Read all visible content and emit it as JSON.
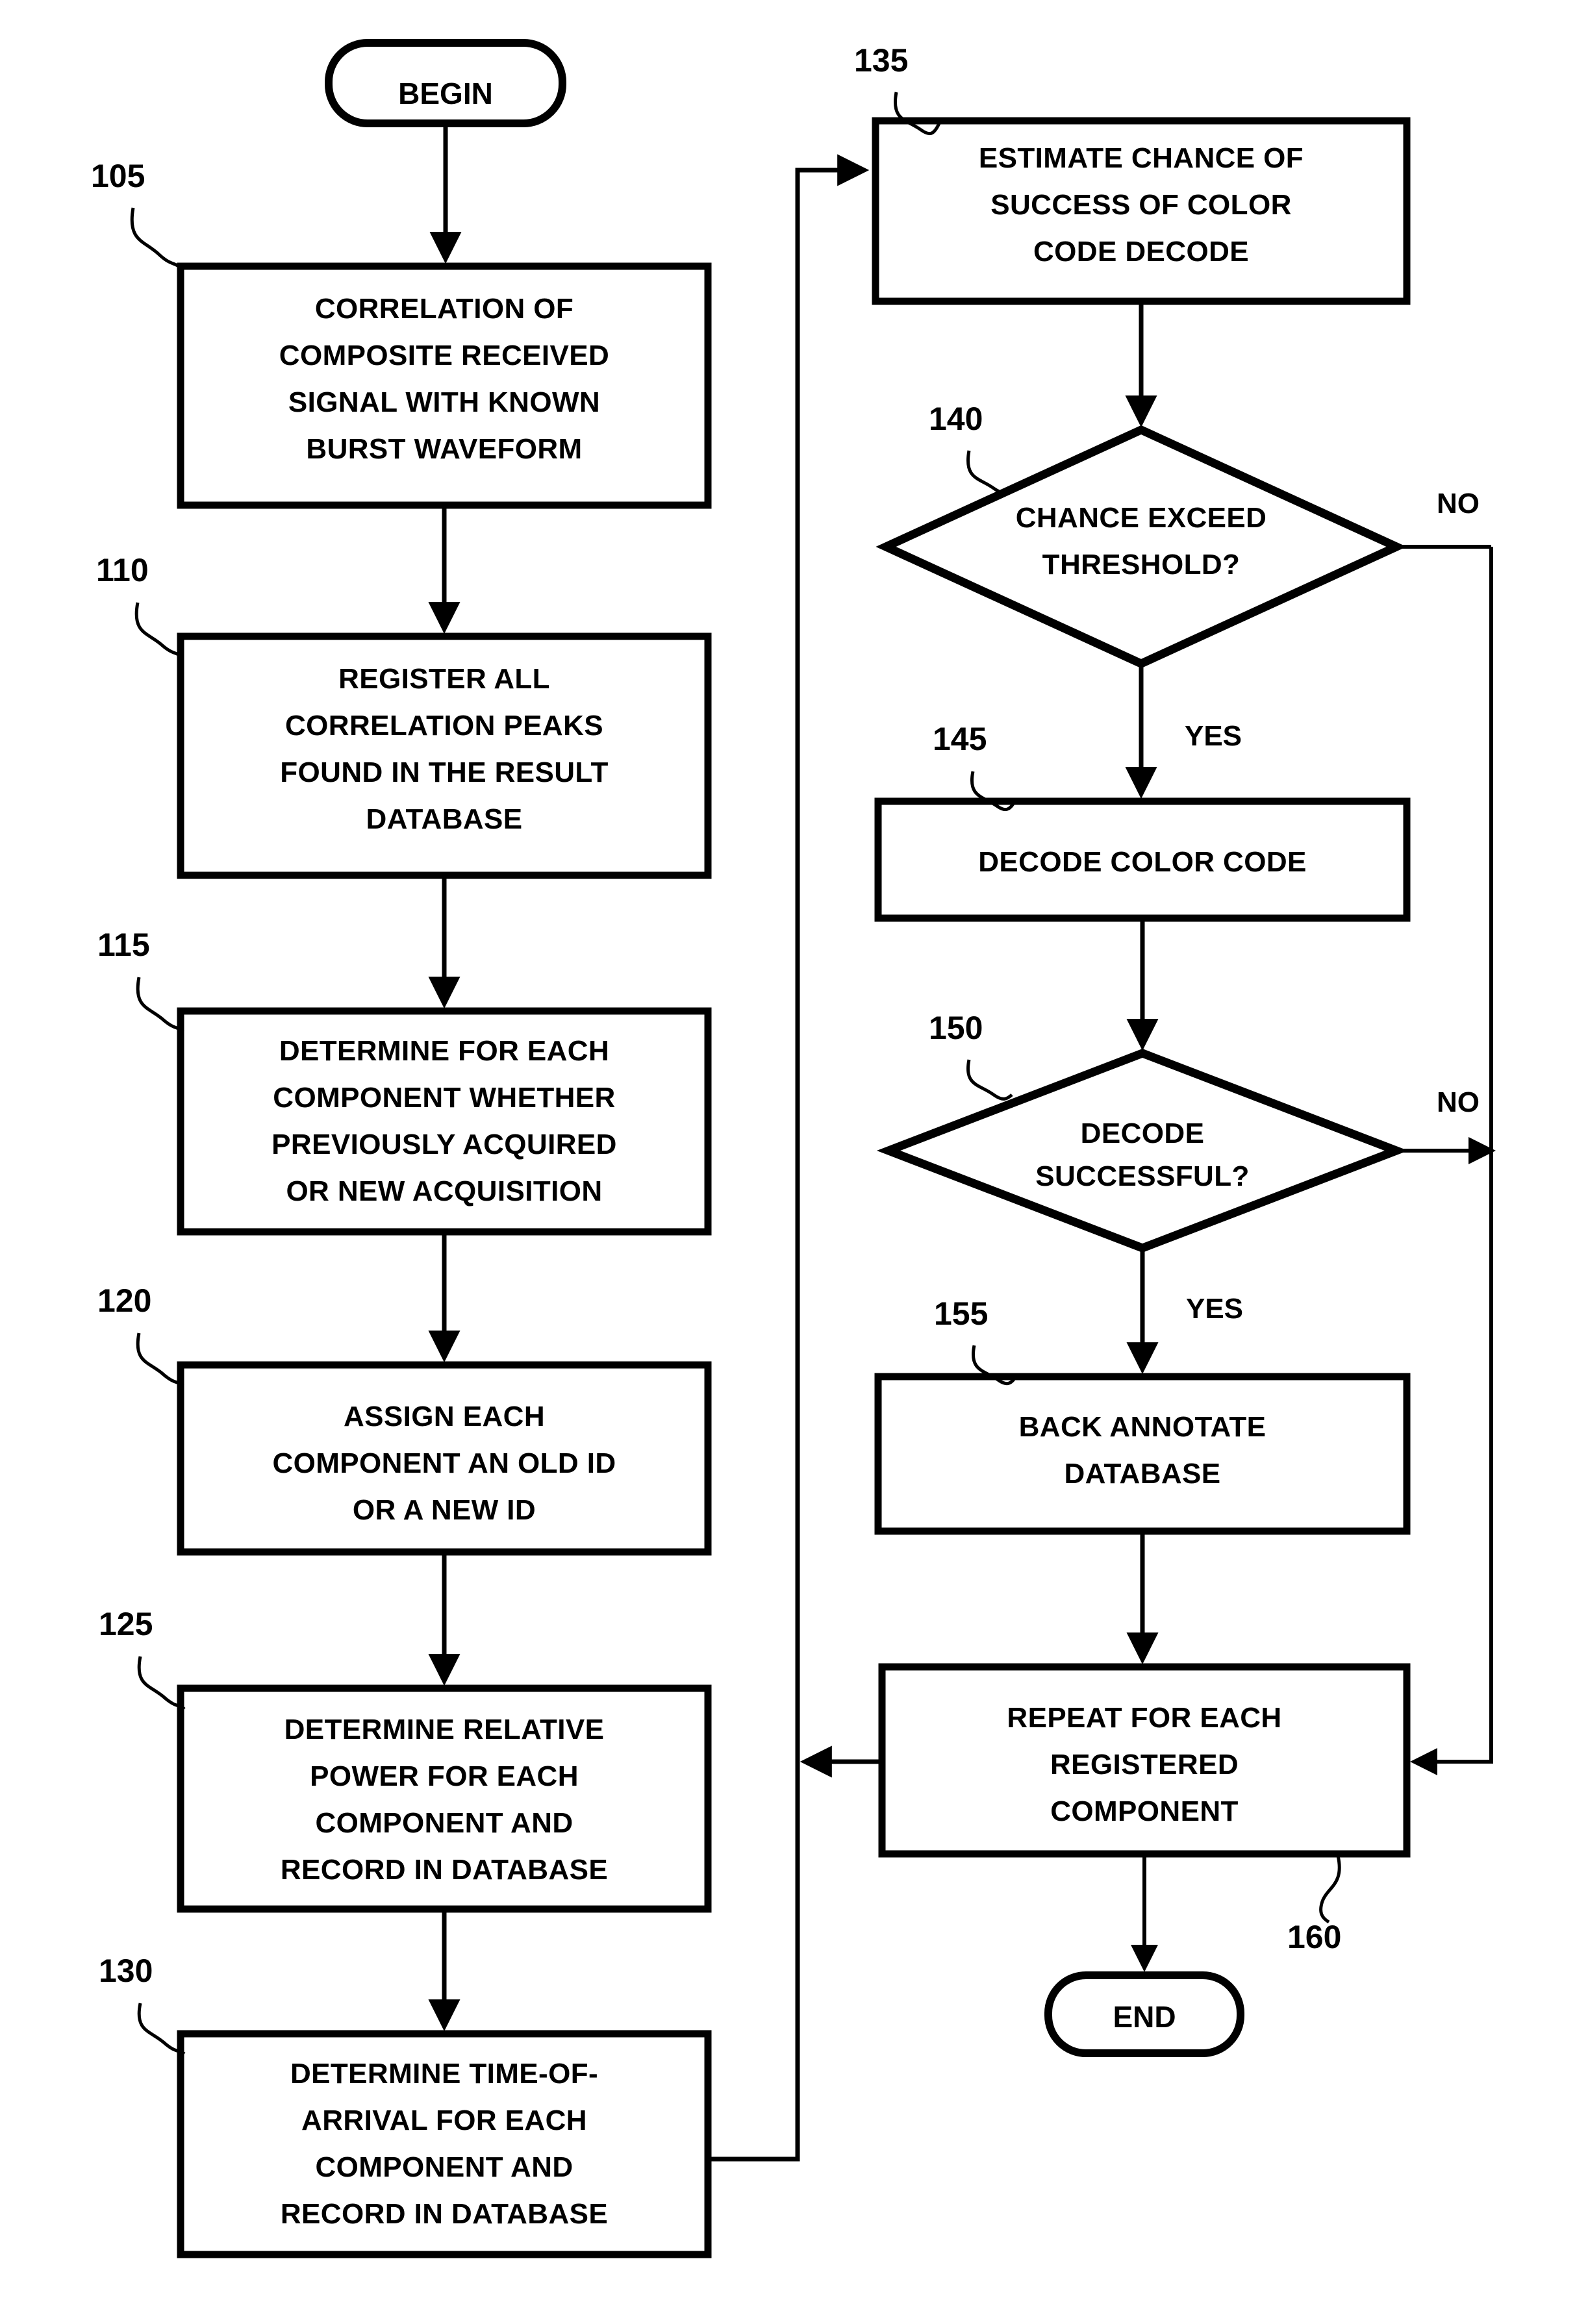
{
  "diagram": {
    "type": "flowchart",
    "title": "",
    "terminators": {
      "begin": "BEGIN",
      "end": "END"
    },
    "nodes": [
      {
        "ref": "105",
        "shape": "process",
        "lines": [
          "CORRELATION OF",
          "COMPOSITE RECEIVED",
          "SIGNAL WITH KNOWN",
          "BURST WAVEFORM"
        ]
      },
      {
        "ref": "110",
        "shape": "process",
        "lines": [
          "REGISTER ALL",
          "CORRELATION PEAKS",
          "FOUND IN THE RESULT",
          "DATABASE"
        ]
      },
      {
        "ref": "115",
        "shape": "process",
        "lines": [
          "DETERMINE FOR EACH",
          "COMPONENT WHETHER",
          "PREVIOUSLY ACQUIRED",
          "OR NEW ACQUISITION"
        ]
      },
      {
        "ref": "120",
        "shape": "process",
        "lines": [
          "ASSIGN EACH",
          "COMPONENT AN OLD ID",
          "OR A NEW ID"
        ]
      },
      {
        "ref": "125",
        "shape": "process",
        "lines": [
          "DETERMINE RELATIVE",
          "POWER FOR EACH",
          "COMPONENT AND",
          "RECORD IN DATABASE"
        ]
      },
      {
        "ref": "130",
        "shape": "process",
        "lines": [
          "DETERMINE TIME-OF-",
          "ARRIVAL FOR EACH",
          "COMPONENT AND",
          "RECORD IN DATABASE"
        ]
      },
      {
        "ref": "135",
        "shape": "process",
        "lines": [
          "ESTIMATE CHANCE OF",
          "SUCCESS OF COLOR",
          "CODE DECODE"
        ]
      },
      {
        "ref": "140",
        "shape": "decision",
        "lines": [
          "CHANCE EXCEED",
          "THRESHOLD?"
        ]
      },
      {
        "ref": "145",
        "shape": "process",
        "lines": [
          "DECODE COLOR CODE"
        ]
      },
      {
        "ref": "150",
        "shape": "decision",
        "lines": [
          "DECODE",
          "SUCCESSFUL?"
        ]
      },
      {
        "ref": "155",
        "shape": "process",
        "lines": [
          "BACK ANNOTATE",
          "DATABASE"
        ]
      },
      {
        "ref": "160",
        "shape": "process",
        "lines": [
          "REPEAT FOR EACH",
          "REGISTERED",
          "COMPONENT"
        ]
      }
    ],
    "edge_labels": {
      "d140_no": "NO",
      "d140_yes": "YES",
      "d150_no": "NO",
      "d150_yes": "YES"
    },
    "colors": {
      "stroke": "#000000",
      "fill": "#ffffff"
    }
  }
}
